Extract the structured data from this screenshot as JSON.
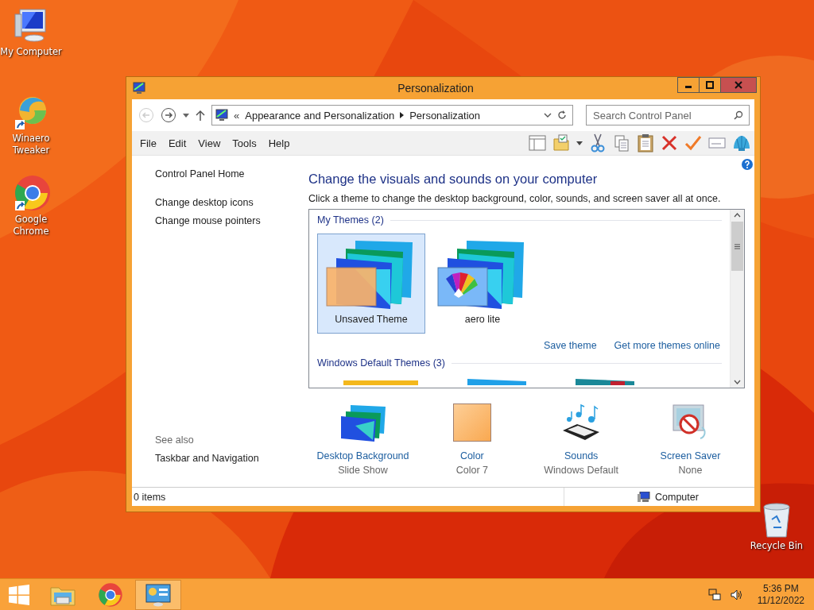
{
  "desktop_icons": [
    {
      "label": "My Computer",
      "kind": "computer"
    },
    {
      "label": "Winaero Tweaker",
      "kind": "tweaker"
    },
    {
      "label": "Google Chrome",
      "kind": "chrome"
    }
  ],
  "recycle_bin": {
    "label": "Recycle Bin"
  },
  "window": {
    "title": "Personalization",
    "address": {
      "overflow": "«",
      "crumbs": [
        "Appearance and Personalization",
        "Personalization"
      ]
    },
    "search": {
      "placeholder": "Search Control Panel"
    },
    "menu": [
      "File",
      "Edit",
      "View",
      "Tools",
      "Help"
    ],
    "sidebar": {
      "items": [
        "Control Panel Home",
        "Change desktop icons",
        "Change mouse pointers"
      ],
      "see_also_label": "See also",
      "see_also": [
        "Taskbar and Navigation"
      ]
    },
    "heading": "Change the visuals and sounds on your computer",
    "description": "Click a theme to change the desktop background, color, sounds, and screen saver all at once.",
    "theme_groups": [
      {
        "title": "My Themes (2)",
        "themes": [
          {
            "name": "Unsaved Theme",
            "selected": true,
            "kind": "color"
          },
          {
            "name": "aero lite",
            "selected": false,
            "kind": "palette"
          }
        ]
      },
      {
        "title": "Windows Default Themes (3)"
      }
    ],
    "theme_links": [
      "Save theme",
      "Get more themes online"
    ],
    "settings": [
      {
        "label": "Desktop Background",
        "value": "Slide Show",
        "kind": "background"
      },
      {
        "label": "Color",
        "value": "Color 7",
        "kind": "color"
      },
      {
        "label": "Sounds",
        "value": "Windows Default",
        "kind": "sounds"
      },
      {
        "label": "Screen Saver",
        "value": "None",
        "kind": "screensaver"
      }
    ],
    "status_bar": {
      "items": "0 items",
      "location": "Computer"
    }
  },
  "taskbar": {
    "apps": [
      {
        "kind": "explorer",
        "selected": false
      },
      {
        "kind": "chrome",
        "selected": false
      },
      {
        "kind": "control_panel",
        "selected": true
      }
    ],
    "time": "5:36 PM",
    "date": "11/12/2022"
  }
}
